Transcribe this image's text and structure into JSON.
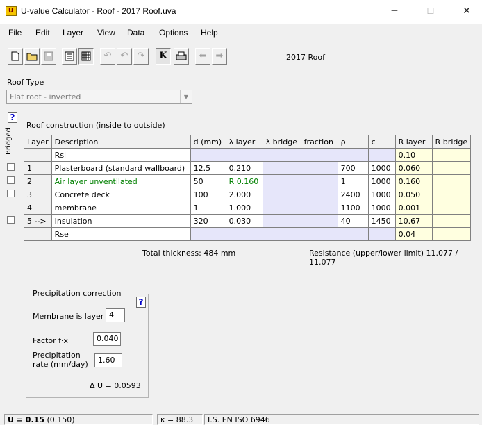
{
  "window": {
    "title": "U-value Calculator - Roof - 2017 Roof.uva",
    "app_icon_text": "U",
    "controls": {
      "minimize": "─",
      "maximize": "☐",
      "close": "✕"
    }
  },
  "menu": [
    "File",
    "Edit",
    "Layer",
    "View",
    "Data",
    "Options",
    "Help"
  ],
  "toolbar": {
    "doc_name": "2017 Roof",
    "kappa_glyph": "K",
    "icons": [
      "new-file-icon",
      "open-folder-icon",
      "save-icon",
      "view-icon",
      "calc-grid-icon",
      "undo-icon",
      "redo-icon",
      "undo-all-icon",
      "kappa-icon",
      "print-icon",
      "back-arrow-icon",
      "forward-arrow-icon"
    ]
  },
  "roof_type": {
    "label": "Roof Type",
    "value": "Flat roof - inverted"
  },
  "help_glyph": "?",
  "bridged_label": "Bridged",
  "construction_label": "Roof construction (inside to outside)",
  "table": {
    "headers": [
      "Layer",
      "Description",
      "d (mm)",
      "λ layer",
      "λ bridge",
      "fraction",
      "ρ",
      "c",
      "R layer",
      "R bridge"
    ],
    "rows": [
      {
        "layer": "",
        "desc": "Rsi",
        "d": "",
        "lam": "",
        "lamb": "",
        "frac": "",
        "rho": "",
        "c": "",
        "r": "0.10",
        "rb": "",
        "checkbox": false,
        "green": false
      },
      {
        "layer": "1",
        "desc": "Plasterboard (standard wallboard)",
        "d": "12.5",
        "lam": "0.210",
        "lamb": "",
        "frac": "",
        "rho": "700",
        "c": "1000",
        "r": "0.060",
        "rb": "",
        "checkbox": true,
        "green": false
      },
      {
        "layer": "2",
        "desc": "Air layer unventilated",
        "d": "50",
        "lam": "R 0.160",
        "lamb": "",
        "frac": "",
        "rho": "1",
        "c": "1000",
        "r": "0.160",
        "rb": "",
        "checkbox": true,
        "green": true
      },
      {
        "layer": "3",
        "desc": "Concrete deck",
        "d": "100",
        "lam": "2.000",
        "lamb": "",
        "frac": "",
        "rho": "2400",
        "c": "1000",
        "r": "0.050",
        "rb": "",
        "checkbox": true,
        "green": false
      },
      {
        "layer": "4",
        "desc": "membrane",
        "d": "1",
        "lam": "1.000",
        "lamb": "",
        "frac": "",
        "rho": "1100",
        "c": "1000",
        "r": "0.001",
        "rb": "",
        "checkbox": false,
        "green": false
      },
      {
        "layer": "5  -->",
        "desc": "Insulation",
        "d": "320",
        "lam": "0.030",
        "lamb": "",
        "frac": "",
        "rho": "40",
        "c": "1450",
        "r": "10.67",
        "rb": "",
        "checkbox": true,
        "green": false
      },
      {
        "layer": "",
        "desc": "Rse",
        "d": "",
        "lam": "",
        "lamb": "",
        "frac": "",
        "rho": "",
        "c": "",
        "r": "0.04",
        "rb": "",
        "checkbox": false,
        "green": false
      }
    ]
  },
  "totals": {
    "thickness": "Total thickness:  484 mm",
    "resistance": "Resistance (upper/lower limit)  11.077 / 11.077"
  },
  "precipitation": {
    "title": "Precipitation correction",
    "membrane_label": "Membrane is layer",
    "membrane_value": "4",
    "factor_label": "Factor f·x",
    "factor_value": "0.040",
    "rate_label_1": "Precipitation",
    "rate_label_2": "rate (mm/day)",
    "rate_value": "1.60",
    "delta_u": "Δ U = 0.0593"
  },
  "status": {
    "u_bold": "U = 0.15",
    "u_paren": "(0.150)",
    "kappa": "κ = 88.3",
    "standard": "I.S. EN ISO 6946"
  },
  "colors": {
    "lambda_col": "#e6e6fa",
    "r_col": "#ffffe0",
    "green_text": "#008000",
    "help_blue": "#0000c8"
  }
}
